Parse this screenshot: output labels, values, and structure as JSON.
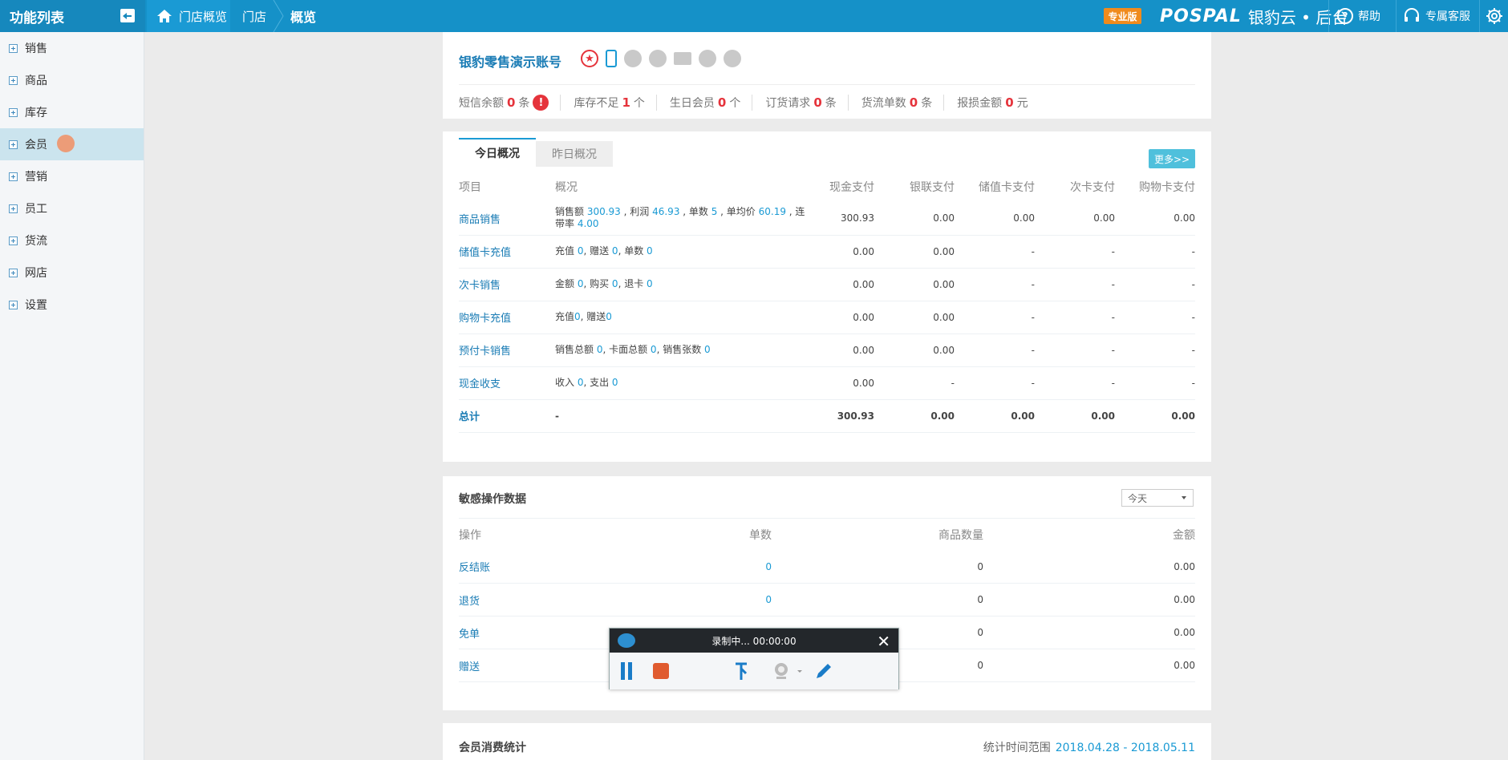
{
  "topbar": {
    "menu_title": "功能列表",
    "crumb_home": "门店概览",
    "crumb_store": "门店",
    "crumb_current": "概览",
    "edition_badge": "专业版",
    "brand_logo": "POSPAL",
    "brand_text": "银豹云 • 后台",
    "help_label": "帮助",
    "service_label": "专属客服",
    "help_icon_glyph": "?",
    "colors": {
      "bar": "#1591c8",
      "badge": "#f08b1d"
    }
  },
  "sidebar": {
    "items": [
      {
        "label": "销售"
      },
      {
        "label": "商品"
      },
      {
        "label": "库存"
      },
      {
        "label": "会员"
      },
      {
        "label": "营销"
      },
      {
        "label": "员工"
      },
      {
        "label": "货流"
      },
      {
        "label": "网店"
      },
      {
        "label": "设置"
      }
    ],
    "active_index": 3
  },
  "account": {
    "title": "银豹零售演示账号",
    "icons": [
      "star-icon",
      "phone-icon",
      "chat-icon",
      "message-icon",
      "mail-icon",
      "check-icon",
      "user-icon"
    ],
    "stats": [
      {
        "label": "短信余额",
        "value": "0",
        "unit": "条",
        "alert": "!"
      },
      {
        "label": "库存不足",
        "value": "1",
        "unit": "个"
      },
      {
        "label": "生日会员",
        "value": "0",
        "unit": "个"
      },
      {
        "label": "订货请求",
        "value": "0",
        "unit": "条"
      },
      {
        "label": "货流单数",
        "value": "0",
        "unit": "条"
      },
      {
        "label": "报损金额",
        "value": "0",
        "unit": "元"
      }
    ]
  },
  "overview": {
    "tab_today": "今日概况",
    "tab_yesterday": "昨日概况",
    "more_label": "更多>>",
    "headers": [
      "项目",
      "概况",
      "现金支付",
      "银联支付",
      "储值卡支付",
      "次卡支付",
      "购物卡支付"
    ],
    "rows": [
      {
        "name": "商品销售",
        "desc": [
          [
            "销售额 ",
            "300.93"
          ],
          [
            " , 利润 ",
            "46.93"
          ],
          [
            " , 单数 ",
            "5"
          ],
          [
            " , 单均价 ",
            "60.19"
          ],
          [
            " , 连带率 ",
            "4.00"
          ]
        ],
        "cash": "300.93",
        "union": "0.00",
        "stored": "0.00",
        "times": "0.00",
        "shop": "0.00"
      },
      {
        "name": "储值卡充值",
        "desc": [
          [
            "充值 ",
            "0"
          ],
          [
            ", 赠送 ",
            "0"
          ],
          [
            ", 单数 ",
            "0"
          ]
        ],
        "cash": "0.00",
        "union": "0.00",
        "stored": "-",
        "times": "-",
        "shop": "-"
      },
      {
        "name": "次卡销售",
        "desc": [
          [
            "金额 ",
            "0"
          ],
          [
            ", 购买 ",
            "0"
          ],
          [
            ", 退卡 ",
            "0"
          ]
        ],
        "cash": "0.00",
        "union": "0.00",
        "stored": "-",
        "times": "-",
        "shop": "-"
      },
      {
        "name": "购物卡充值",
        "desc": [
          [
            "充值",
            "0"
          ],
          [
            ", 赠送",
            "0"
          ]
        ],
        "cash": "0.00",
        "union": "0.00",
        "stored": "-",
        "times": "-",
        "shop": "-"
      },
      {
        "name": "预付卡销售",
        "desc": [
          [
            "销售总额 ",
            "0"
          ],
          [
            ", 卡面总额 ",
            "0"
          ],
          [
            ", 销售张数 ",
            "0"
          ]
        ],
        "cash": "0.00",
        "union": "0.00",
        "stored": "-",
        "times": "-",
        "shop": "-"
      },
      {
        "name": "现金收支",
        "desc": [
          [
            "收入 ",
            "0"
          ],
          [
            ", 支出 ",
            "0"
          ]
        ],
        "cash": "0.00",
        "union": "-",
        "stored": "-",
        "times": "-",
        "shop": "-"
      }
    ],
    "total": {
      "name": "总计",
      "desc": "-",
      "cash": "300.93",
      "union": "0.00",
      "stored": "0.00",
      "times": "0.00",
      "shop": "0.00"
    }
  },
  "sensitive": {
    "title": "敏感操作数据",
    "period_selected": "今天",
    "headers": [
      "操作",
      "单数",
      "商品数量",
      "金额"
    ],
    "rows": [
      {
        "op": "反结账",
        "count": "0",
        "qty": "0",
        "amount": "0.00"
      },
      {
        "op": "退货",
        "count": "0",
        "qty": "0",
        "amount": "0.00"
      },
      {
        "op": "免单",
        "count": "",
        "qty": "0",
        "amount": "0.00"
      },
      {
        "op": "赠送",
        "count": "",
        "qty": "0",
        "amount": "0.00"
      }
    ]
  },
  "member_stats": {
    "title": "会员消费统计",
    "range_label": "统计时间范围",
    "range_value": "2018.04.28 - 2018.05.11"
  },
  "recorder": {
    "status": "录制中... 00:00:00",
    "close_glyph": "✕"
  }
}
